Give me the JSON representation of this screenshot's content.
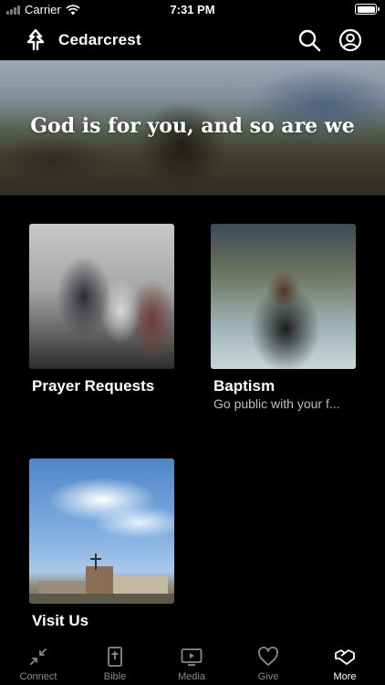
{
  "status_bar": {
    "carrier": "Carrier",
    "time": "7:31 PM"
  },
  "nav": {
    "brand_name": "Cedarcrest",
    "brand_icon": "cedar-logo-icon",
    "search_icon": "search-icon",
    "profile_icon": "profile-icon"
  },
  "hero": {
    "title": "God is for you, and so are we"
  },
  "cards": [
    {
      "title": "Prayer Requests",
      "subtitle": ""
    },
    {
      "title": "Baptism",
      "subtitle": "Go public with your f..."
    },
    {
      "title": "Visit Us",
      "subtitle": ""
    }
  ],
  "tabs": [
    {
      "label": "Connect",
      "icon": "connect-icon",
      "active": false
    },
    {
      "label": "Bible",
      "icon": "bible-icon",
      "active": false
    },
    {
      "label": "Media",
      "icon": "media-play-icon",
      "active": false
    },
    {
      "label": "Give",
      "icon": "heart-icon",
      "active": false
    },
    {
      "label": "More",
      "icon": "more-handshake-icon",
      "active": true
    }
  ],
  "colors": {
    "background": "#000000",
    "text": "#ffffff",
    "subtext": "#bdbdbd",
    "tab_inactive": "#8a8a8a"
  }
}
